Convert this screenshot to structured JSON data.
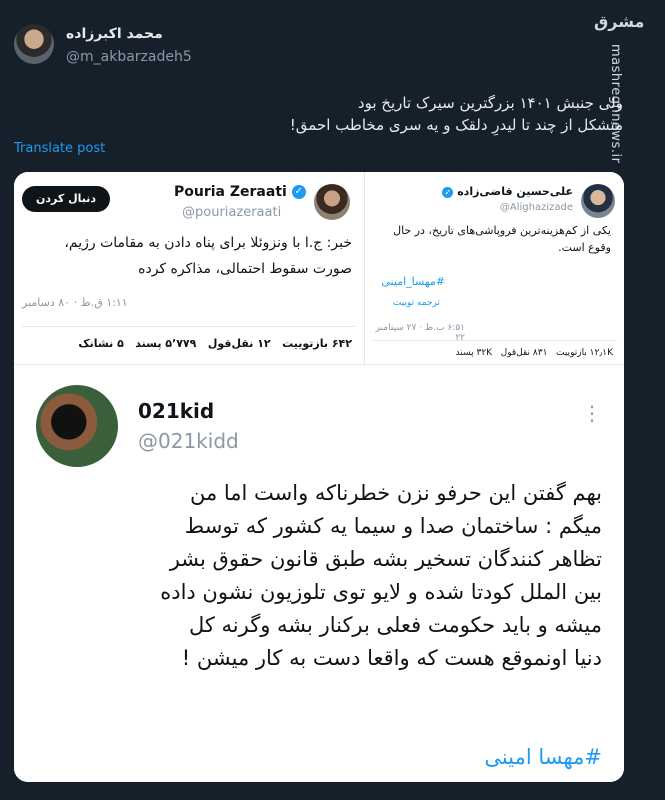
{
  "author": {
    "name": "محمد اکبرزاده",
    "handle": "@m_akbarzadeh5"
  },
  "watermark": {
    "logo_text": "مشرق",
    "site": "mashreghnews.ir"
  },
  "post": {
    "lines": [
      "ولی جنبش ۱۴۰۱ بزرگترین سیرک تاریخ بود",
      "متشکل از چند تا لیدرِ دلقک و یه سری مخاطب احمق!"
    ],
    "translate": "Translate post"
  },
  "quoted_right": {
    "name": "علی‌حسین قاضی‌زاده",
    "handle": "@Alighazizade",
    "text": "یکی از کم‌هزینه‌ترین فروپاشی‌های تاریخ، در حال وقوع است.",
    "hashtag": "#مهسا_امینی",
    "translate": "ترجمه توییت",
    "timestamp": "۶:۵۱ ب.ظ · ۲۷ سپتامبر ۲۲",
    "stats": "۱۲٫۱K بازتوییت   ۸۳۱ نقل‌قول   ۳۲K پسند"
  },
  "quoted_left": {
    "name": "Pouria Zeraati",
    "handle": "@pouriazeraati",
    "follow": "دنبال کردن",
    "text": "خبر: ج.ا با ونزوئلا برای پناه دادن به مقامات رژیم، صورت سقوط احتمالی، مذاکره کرده",
    "timestamp": "۱:۱۱ ق.ظ · ۸۰ دسامبر",
    "stats": "۶۴۲ بازتوییت   ۱۲ نقل‌قول   ۵٬۷۷۹ پسند   ۵ نشانک"
  },
  "kid": {
    "name": "021kid",
    "handle": "@021kidd",
    "more": "⋮",
    "lines": [
      "بهم گفتن این حرفو نزن خطرناکه واست اما من",
      "میگم : ساختمان صدا و سیما یه کشور که توسط",
      "تظاهر کنندگان تسخیر بشه طبق قانون حقوق بشر",
      "بین الملل کودتا شده و لایو توی تلوزیون نشون داده",
      "میشه و باید حکومت فعلی برکنار بشه وگرنه کل",
      "دنیا اونموقع هست که واقعا دست به کار میشن !"
    ],
    "hashtag": "#مهسا امینی"
  },
  "colors": {
    "background": "#15202b",
    "accent": "#1d9bf0",
    "card": "#ffffff"
  }
}
